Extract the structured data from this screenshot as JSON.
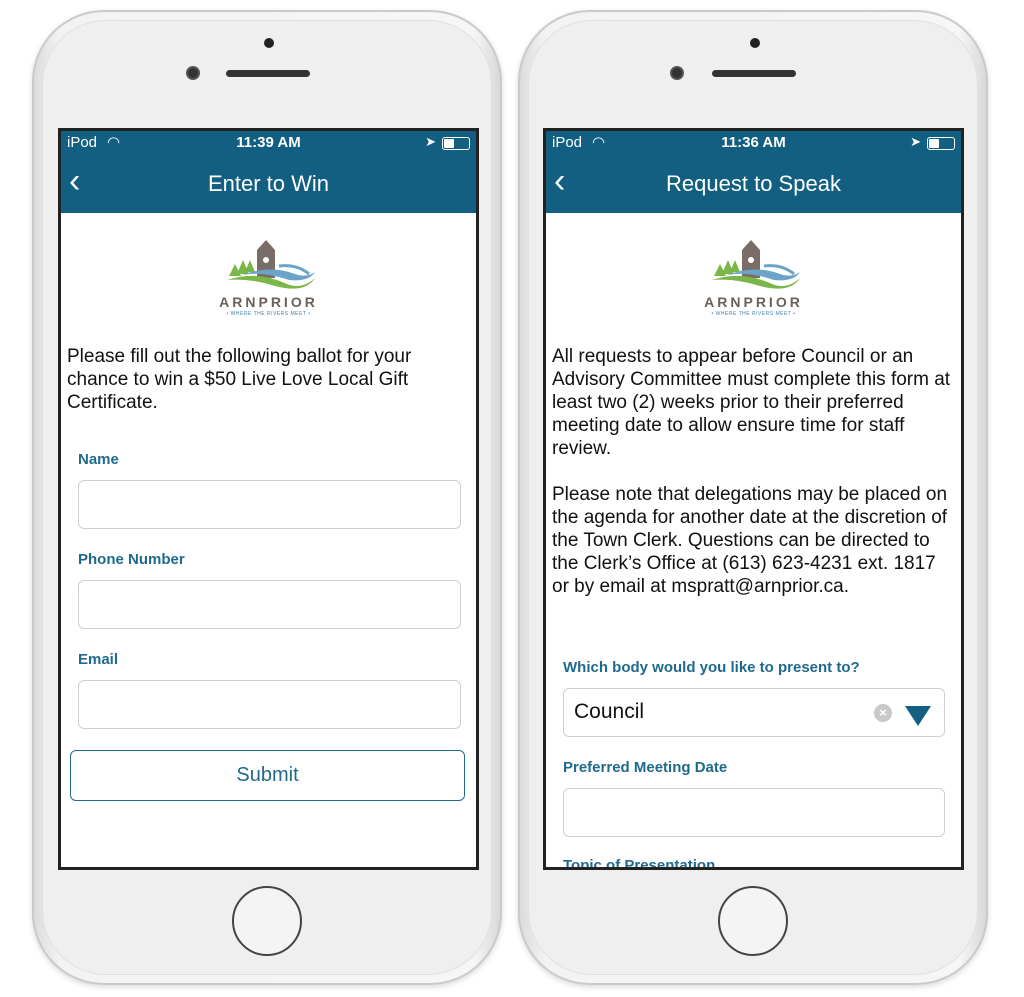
{
  "left_phone": {
    "status": {
      "carrier": "iPod",
      "time": "11:39 AM"
    },
    "nav": {
      "title": "Enter to Win"
    },
    "logo": {
      "name": "ARNPRIOR",
      "tagline": "• WHERE THE RIVERS MEET •"
    },
    "intro": "Please fill out the following ballot for your chance to win a $50 Live Love Local Gift Certificate.",
    "fields": [
      {
        "label": "Name",
        "value": ""
      },
      {
        "label": "Phone Number",
        "value": ""
      },
      {
        "label": "Email",
        "value": ""
      }
    ],
    "submit_label": "Submit"
  },
  "right_phone": {
    "status": {
      "carrier": "iPod",
      "time": "11:36 AM"
    },
    "nav": {
      "title": "Request to Speak"
    },
    "logo": {
      "name": "ARNPRIOR",
      "tagline": "• WHERE THE RIVERS MEET •"
    },
    "para1": "All requests to appear before Council or an Advisory Committee must complete this form at least two (2) weeks prior to their preferred meeting date to allow ensure time for staff review.",
    "para2": "Please note that delegations may be placed on the agenda for another date at the discretion of the Town Clerk. Questions can be directed to the Clerk’s Office at (613) 623-4231 ext. 1817 or by email at mspratt@arnprior.ca.",
    "body_label": "Which body would you like to present to?",
    "body_value": "Council",
    "date_label": "Preferred Meeting Date",
    "date_value": "",
    "topic_label": "Topic of Presentation"
  },
  "colors": {
    "nav": "#125f82",
    "label": "#1f6a8c"
  }
}
